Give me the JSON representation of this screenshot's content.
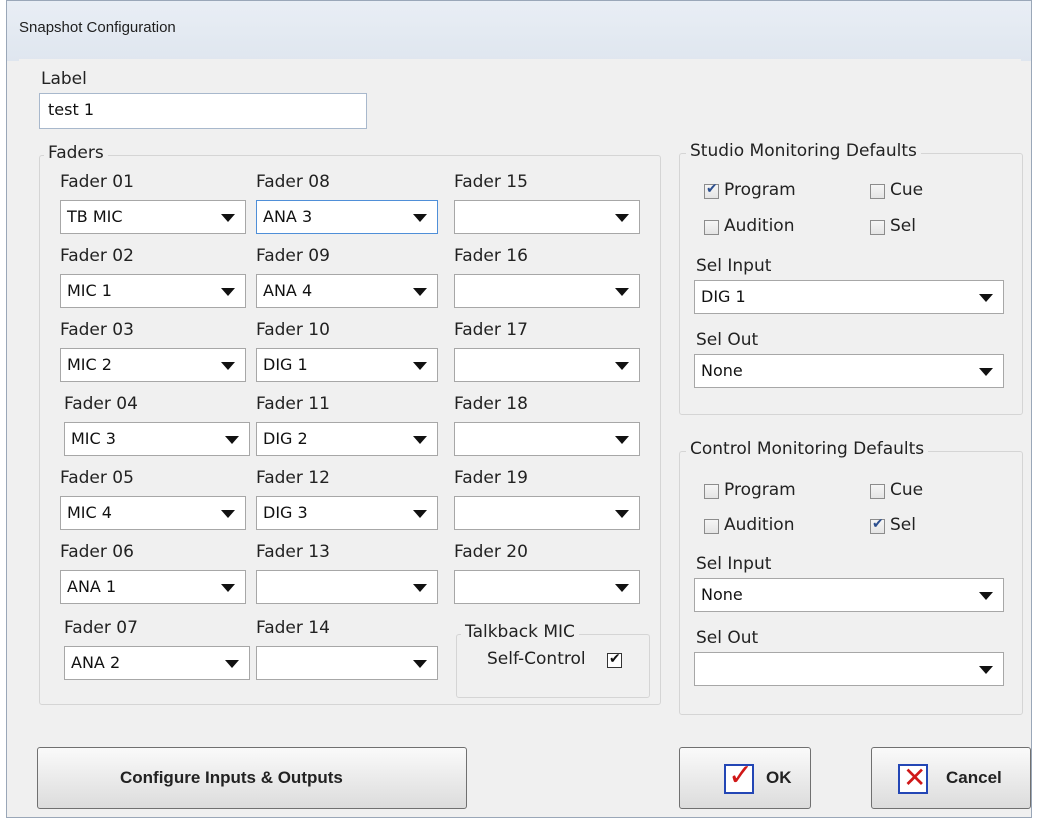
{
  "window": {
    "title": "Snapshot Configuration"
  },
  "label": {
    "caption": "Label",
    "value": "test 1"
  },
  "faders": {
    "caption": "Faders",
    "items": [
      {
        "name": "Fader 01",
        "value": "TB MIC"
      },
      {
        "name": "Fader 02",
        "value": "MIC 1"
      },
      {
        "name": "Fader 03",
        "value": "MIC 2"
      },
      {
        "name": "Fader 04",
        "value": "MIC 3"
      },
      {
        "name": "Fader 05",
        "value": "MIC 4"
      },
      {
        "name": "Fader 06",
        "value": "ANA 1"
      },
      {
        "name": "Fader 07",
        "value": "ANA 2"
      },
      {
        "name": "Fader 08",
        "value": "ANA 3"
      },
      {
        "name": "Fader 09",
        "value": "ANA 4"
      },
      {
        "name": "Fader 10",
        "value": "DIG 1"
      },
      {
        "name": "Fader 11",
        "value": "DIG 2"
      },
      {
        "name": "Fader 12",
        "value": "DIG 3"
      },
      {
        "name": "Fader 13",
        "value": ""
      },
      {
        "name": "Fader 14",
        "value": ""
      },
      {
        "name": "Fader 15",
        "value": ""
      },
      {
        "name": "Fader 16",
        "value": ""
      },
      {
        "name": "Fader 17",
        "value": ""
      },
      {
        "name": "Fader 18",
        "value": ""
      },
      {
        "name": "Fader 19",
        "value": ""
      },
      {
        "name": "Fader 20",
        "value": ""
      }
    ],
    "talkback": {
      "caption": "Talkback MIC",
      "self_control_label": "Self-Control",
      "self_control_checked": true
    }
  },
  "studio": {
    "caption": "Studio Monitoring Defaults",
    "program": {
      "label": "Program",
      "checked": true
    },
    "cue": {
      "label": "Cue",
      "checked": false
    },
    "audition": {
      "label": "Audition",
      "checked": false
    },
    "sel": {
      "label": "Sel",
      "checked": false
    },
    "sel_input": {
      "label": "Sel Input",
      "value": "DIG 1"
    },
    "sel_out": {
      "label": "Sel Out",
      "value": "None"
    }
  },
  "control": {
    "caption": "Control Monitoring Defaults",
    "program": {
      "label": "Program",
      "checked": false
    },
    "cue": {
      "label": "Cue",
      "checked": false
    },
    "audition": {
      "label": "Audition",
      "checked": false
    },
    "sel": {
      "label": "Sel",
      "checked": true
    },
    "sel_input": {
      "label": "Sel Input",
      "value": "None"
    },
    "sel_out": {
      "label": "Sel Out",
      "value": ""
    }
  },
  "buttons": {
    "configure": "Configure Inputs & Outputs",
    "ok": "OK",
    "cancel": "Cancel"
  }
}
